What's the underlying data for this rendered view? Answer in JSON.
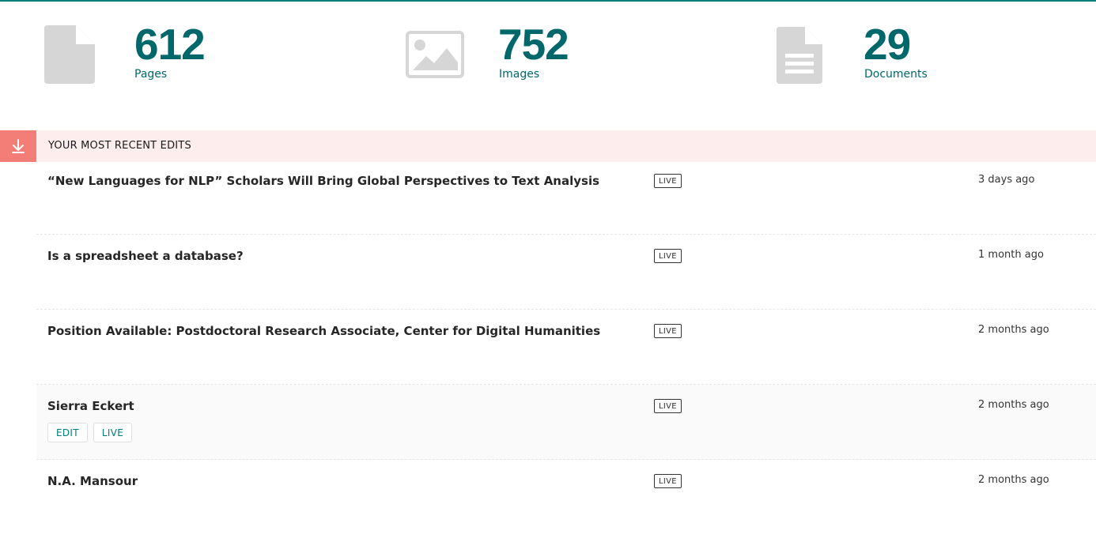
{
  "stats": {
    "pages": {
      "count": "612",
      "label": "Pages",
      "icon": "page-icon"
    },
    "images": {
      "count": "752",
      "label": "Images",
      "icon": "image-icon"
    },
    "documents": {
      "count": "29",
      "label": "Documents",
      "icon": "document-icon"
    }
  },
  "recent_edits": {
    "title": "YOUR MOST RECENT EDITS",
    "rows": [
      {
        "title": "“New Languages for NLP” Scholars Will Bring Global Perspectives to Text Analysis",
        "status": "LIVE",
        "when": "3 days ago"
      },
      {
        "title": "Is a spreadsheet a database?",
        "status": "LIVE",
        "when": "1 month ago"
      },
      {
        "title": "Position Available: Postdoctoral Research Associate, Center for Digital Humanities",
        "status": "LIVE",
        "when": "2 months ago"
      },
      {
        "title": "Sierra Eckert",
        "status": "LIVE",
        "when": "2 months ago",
        "actions": {
          "edit": "EDIT",
          "live": "LIVE"
        }
      },
      {
        "title": "N.A. Mansour",
        "status": "LIVE",
        "when": "2 months ago"
      }
    ]
  },
  "colors": {
    "accent": "#007d7e",
    "stat_number": "#00676a",
    "section_bg": "#fdeeed",
    "toggle_bg": "#f37e77",
    "icon_gray": "#d6d6d6"
  }
}
